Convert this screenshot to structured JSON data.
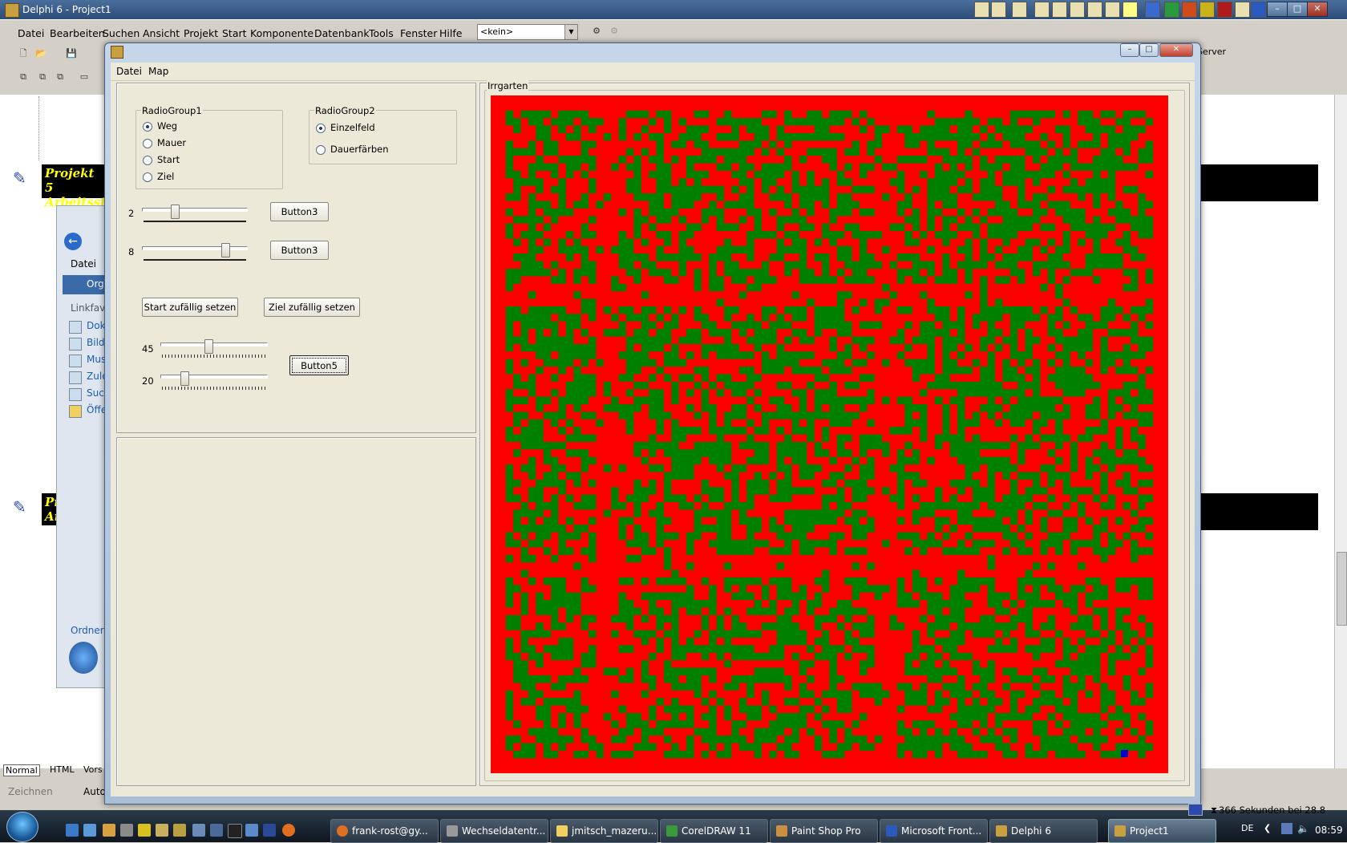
{
  "ide": {
    "title": "Delphi 6 - Project1",
    "menu": [
      "Datei",
      "Bearbeiten",
      "Suchen",
      "Ansicht",
      "Projekt",
      "Start",
      "Komponente",
      "Datenbank",
      "Tools",
      "Fenster",
      "Hilfe"
    ],
    "component_combo": "<kein>",
    "palette_tail": "Server"
  },
  "background": {
    "editor_heading_1": "Projekt 5",
    "editor_heading_1b": "Arbeitssta",
    "editor_heading_2": "Pr",
    "editor_heading_2b": "Ar",
    "explorer_menu": "Datei",
    "explorer_org": "Org",
    "explorer_section": "Linkfav",
    "explorer_links": [
      "Dok",
      "Bild",
      "Mus",
      "Zule",
      "Suc",
      "Öffe"
    ],
    "explorer_folder_label": "Ordner",
    "view_tabs": [
      "Normal",
      "HTML",
      "Vors"
    ],
    "draw_menu": "Zeichnen",
    "auto_label": "Auto"
  },
  "form": {
    "menu": [
      "Datei",
      "Map"
    ],
    "radiogroup1": {
      "caption": "RadioGroup1",
      "items": [
        "Weg",
        "Mauer",
        "Start",
        "Ziel"
      ],
      "selected": 0
    },
    "radiogroup2": {
      "caption": "RadioGroup2",
      "items": [
        "Einzelfeld",
        "Dauerfärben"
      ],
      "selected": 0
    },
    "slider1": {
      "label": "2",
      "value": 0.3
    },
    "slider2": {
      "label": "8",
      "value": 0.82
    },
    "button3a": "Button3",
    "button3b": "Button3",
    "start_random": "Start zufällig setzen",
    "goal_random": "Ziel zufällig setzen",
    "slider3": {
      "label": "45",
      "value": 0.45
    },
    "slider4": {
      "label": "20",
      "value": 0.2
    },
    "button5": "Button5",
    "maze_caption": "Irrgarten",
    "maze_colors": {
      "path": "#ff0000",
      "wall": "#008000",
      "marker": "#0000cc"
    }
  },
  "taskbar": {
    "items": [
      "frank-rost@gy...",
      "Wechseldatentr...",
      "jmitsch_mazeru...",
      "CorelDRAW 11",
      "Paint Shop Pro",
      "Microsoft Front...",
      "Delphi 6",
      "Project1"
    ],
    "active": 7,
    "status_text": "366 Sekunden bei 28.8",
    "language": "DE",
    "clock": "08:59"
  }
}
